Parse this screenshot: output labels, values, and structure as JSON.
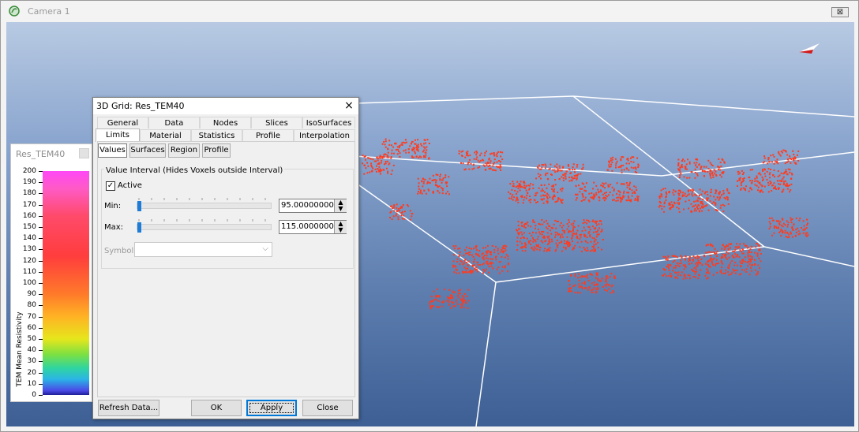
{
  "window": {
    "title": "Camera 1",
    "close_label": "⊠"
  },
  "legend": {
    "title": "Res_TEM40",
    "axis_label": "TEM Mean Resistivity",
    "ticks": [
      "200",
      "190",
      "180",
      "170",
      "160",
      "150",
      "140",
      "130",
      "120",
      "110",
      "100",
      "90",
      "80",
      "70",
      "60",
      "50",
      "40",
      "30",
      "20",
      "10",
      "0"
    ],
    "range": [
      0,
      200
    ]
  },
  "dialog": {
    "title": "3D Grid: Res_TEM40",
    "close_icon": "×",
    "tabs_row1": [
      "General",
      "Data",
      "Nodes",
      "Slices",
      "IsoSurfaces"
    ],
    "tabs_row2": [
      "Limits",
      "Material",
      "Statistics",
      "Profile",
      "Interpolation"
    ],
    "active_tab": "Limits",
    "subtabs": [
      "Values",
      "Surfaces",
      "Region",
      "Profile"
    ],
    "active_subtab": "Values",
    "group_label": "Value Interval (Hides Voxels outside Interval)",
    "active_label": "Active",
    "active_checked": true,
    "min_label": "Min:",
    "min_value": "95.0000000000",
    "min_fraction": 0.0,
    "max_label": "Max:",
    "max_value": "115.000000000",
    "max_fraction": 0.0,
    "symbol_label": "Symbol:",
    "symbol_value": "",
    "buttons": {
      "refresh": "Refresh Data...",
      "ok": "OK",
      "apply": "Apply",
      "close": "Close"
    }
  },
  "colors": {
    "voxel": "#ff3b1f",
    "viewport_top": "#b8cae3",
    "viewport_bottom": "#3d5f94",
    "accent": "#0078d7"
  },
  "icons": {
    "app": "app-logo-icon",
    "compass": "north-arrow-icon"
  }
}
